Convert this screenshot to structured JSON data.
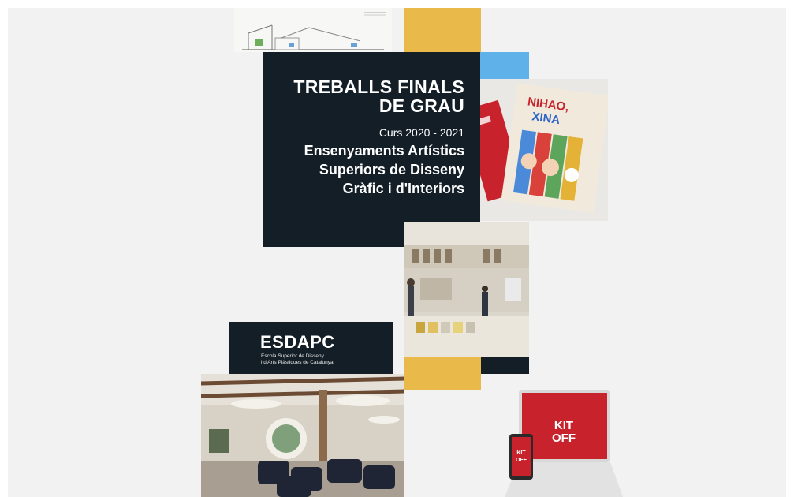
{
  "poster": {
    "title_line1": "TREBALLS FINALS",
    "title_line2": "DE GRAU",
    "course": "Curs 2020 - 2021",
    "subtitle_line1": "Ensenyaments Artístics",
    "subtitle_line2": "Superiors de Disseny",
    "subtitle_line3": "Gràfic i d'Interiors"
  },
  "school": {
    "logo": "ESDAPC",
    "name_line1": "Escola Superior de Disseny",
    "name_line2": "i d'Arts Plàstiques de Catalunya"
  },
  "book": {
    "title_line1": "NIHAO,",
    "title_line2": "XINA"
  },
  "kitoff": {
    "laptop_line1": "KIT",
    "laptop_line2": "OFF",
    "phone_line1": "KIT",
    "phone_line2": "OFF"
  },
  "colors": {
    "navy": "#141e27",
    "yellow": "#e9b949",
    "blue": "#5fb1ea",
    "red": "#c8232c"
  }
}
